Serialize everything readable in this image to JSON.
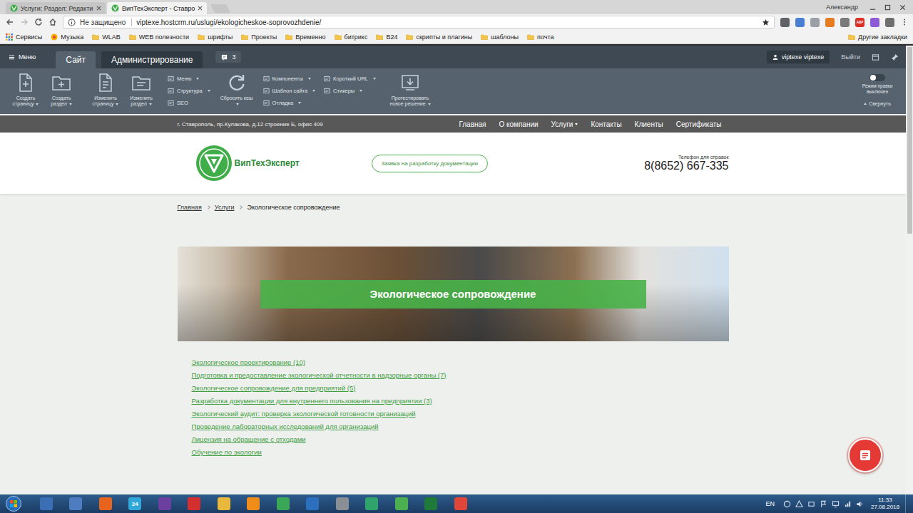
{
  "browser": {
    "tabs": [
      {
        "label": "Услуги: Раздел: Редакти",
        "selected": false
      },
      {
        "label": "ВипТехЭксперт - Ставро",
        "selected": true
      }
    ],
    "profile": "Александр",
    "security": "Не защищено",
    "url": "viptexe.hostcrm.ru/uslugi/ekologicheskoe-soprovozhdenie/",
    "extensions": [
      {
        "color": "#5f6368"
      },
      {
        "color": "#4a7fd4"
      },
      {
        "color": "#9aa0a6"
      },
      {
        "color": "#e67c22"
      },
      {
        "color": "#7a7a7a"
      },
      {
        "color": "#d93025",
        "label": "ABP"
      },
      {
        "color": "#8e5bd6"
      },
      {
        "color": "#6f6f6f"
      }
    ],
    "bookmarks": [
      {
        "label": "Сервисы",
        "kind": "apps"
      },
      {
        "label": "Музыка",
        "kind": "site"
      },
      {
        "label": "WLAB",
        "kind": "folder"
      },
      {
        "label": "WEB полезности",
        "kind": "folder"
      },
      {
        "label": "шрифты",
        "kind": "folder"
      },
      {
        "label": "Проекты",
        "kind": "folder"
      },
      {
        "label": "Временно",
        "kind": "folder"
      },
      {
        "label": "битрикс",
        "kind": "folder"
      },
      {
        "label": "B24",
        "kind": "folder"
      },
      {
        "label": "скрипты и плагины",
        "kind": "folder"
      },
      {
        "label": "шаблоны",
        "kind": "folder"
      },
      {
        "label": "почта",
        "kind": "folder"
      }
    ],
    "other_bookmarks": "Другие закладки"
  },
  "admin": {
    "menu": "Меню",
    "tabs": [
      {
        "label": "Сайт",
        "selected": true
      },
      {
        "label": "Администрирование",
        "selected": false
      }
    ],
    "notifications": "3",
    "user": "viptexe viptexe",
    "logout": "Выйти",
    "toolbar": [
      {
        "kind": "buttons",
        "items": [
          {
            "kind": "page-add",
            "label": "Создать страницу",
            "dropdown": true
          },
          {
            "kind": "folder-add",
            "label": "Создать раздел",
            "dropdown": true
          }
        ]
      },
      {
        "kind": "buttons",
        "items": [
          {
            "kind": "page-edit",
            "label": "Изменить страницу",
            "dropdown": true
          },
          {
            "kind": "folder-edit",
            "label": "Изменить раздел",
            "dropdown": true
          }
        ]
      },
      {
        "kind": "menus",
        "items": [
          {
            "label": "Меню",
            "dropdown": true
          },
          {
            "label": "Структура",
            "dropdown": true
          },
          {
            "label": "SEO",
            "dropdown": false
          }
        ]
      },
      {
        "kind": "buttons",
        "items": [
          {
            "kind": "refresh",
            "label": "Сбросить кеш",
            "dropdown": true
          }
        ]
      },
      {
        "kind": "menus",
        "items": [
          {
            "label": "Компоненты",
            "dropdown": true
          },
          {
            "label": "Шаблон сайта",
            "dropdown": true
          },
          {
            "label": "Отладка",
            "dropdown": true
          }
        ]
      },
      {
        "kind": "menus",
        "items": [
          {
            "label": "Короткий URL",
            "dropdown": true
          },
          {
            "label": "Стикеры",
            "dropdown": true
          }
        ]
      },
      {
        "kind": "buttons",
        "items": [
          {
            "kind": "download",
            "label": "Протестировать новое решение",
            "dropdown": true
          }
        ]
      }
    ],
    "edit_mode": {
      "label": "Режим правки выключен",
      "on": false
    },
    "collapse": "Свернуть"
  },
  "site": {
    "address": "г. Ставрополь, пр.Кулакова, д.12 строение Б, офис 409",
    "nav": [
      {
        "label": "Главная",
        "dropdown": false
      },
      {
        "label": "О компании",
        "dropdown": false
      },
      {
        "label": "Услуги",
        "dropdown": true
      },
      {
        "label": "Контакты",
        "dropdown": false
      },
      {
        "label": "Клиенты",
        "dropdown": false
      },
      {
        "label": "Сертификаты",
        "dropdown": false
      }
    ],
    "logo": "ВипТехЭксперт",
    "request_button": "Заявка на разработку документации",
    "phone_label": "Телефон для справок",
    "phone": "8(8652) 667-335",
    "breadcrumbs": [
      {
        "label": "Главная",
        "current": false
      },
      {
        "label": "Услуги",
        "current": false
      },
      {
        "label": "Экологическое сопровождение",
        "current": true
      }
    ],
    "banner_title": "Экологическое сопровождение",
    "links": [
      "Экологическое проектирование (10)",
      "Подготовка и предоставление экологической отчетности в надзорные органы (7)",
      "Экологическое сопровождение для предприятий (5)",
      "Разработка документации для внутреннего пользования на предприятии (3)",
      "Экологический аудит: проверка экологической готовности организаций",
      "Проведение лабораторных исследований для организаций",
      "Лицензия на обращение с отходами",
      "Обучение по экологии"
    ]
  },
  "taskbar": {
    "apps": [
      {
        "color": "#3a6fb5"
      },
      {
        "color": "#4d7cc0"
      },
      {
        "color": "#e8631c"
      },
      {
        "color": "#2fa7d9",
        "label": "24"
      },
      {
        "color": "#6a3fa0"
      },
      {
        "color": "#d32f2f"
      },
      {
        "color": "#e9b93c"
      },
      {
        "color": "#f08c1a"
      },
      {
        "color": "#3aa757"
      },
      {
        "color": "#2c6fbf"
      },
      {
        "color": "#8a8f96"
      },
      {
        "color": "#2fa36b"
      },
      {
        "color": "#4caf50"
      },
      {
        "color": "#1f7a3a"
      },
      {
        "color": "#e0453a"
      }
    ],
    "language": "EN",
    "time": "11:33",
    "date": "27.08.2018"
  }
}
